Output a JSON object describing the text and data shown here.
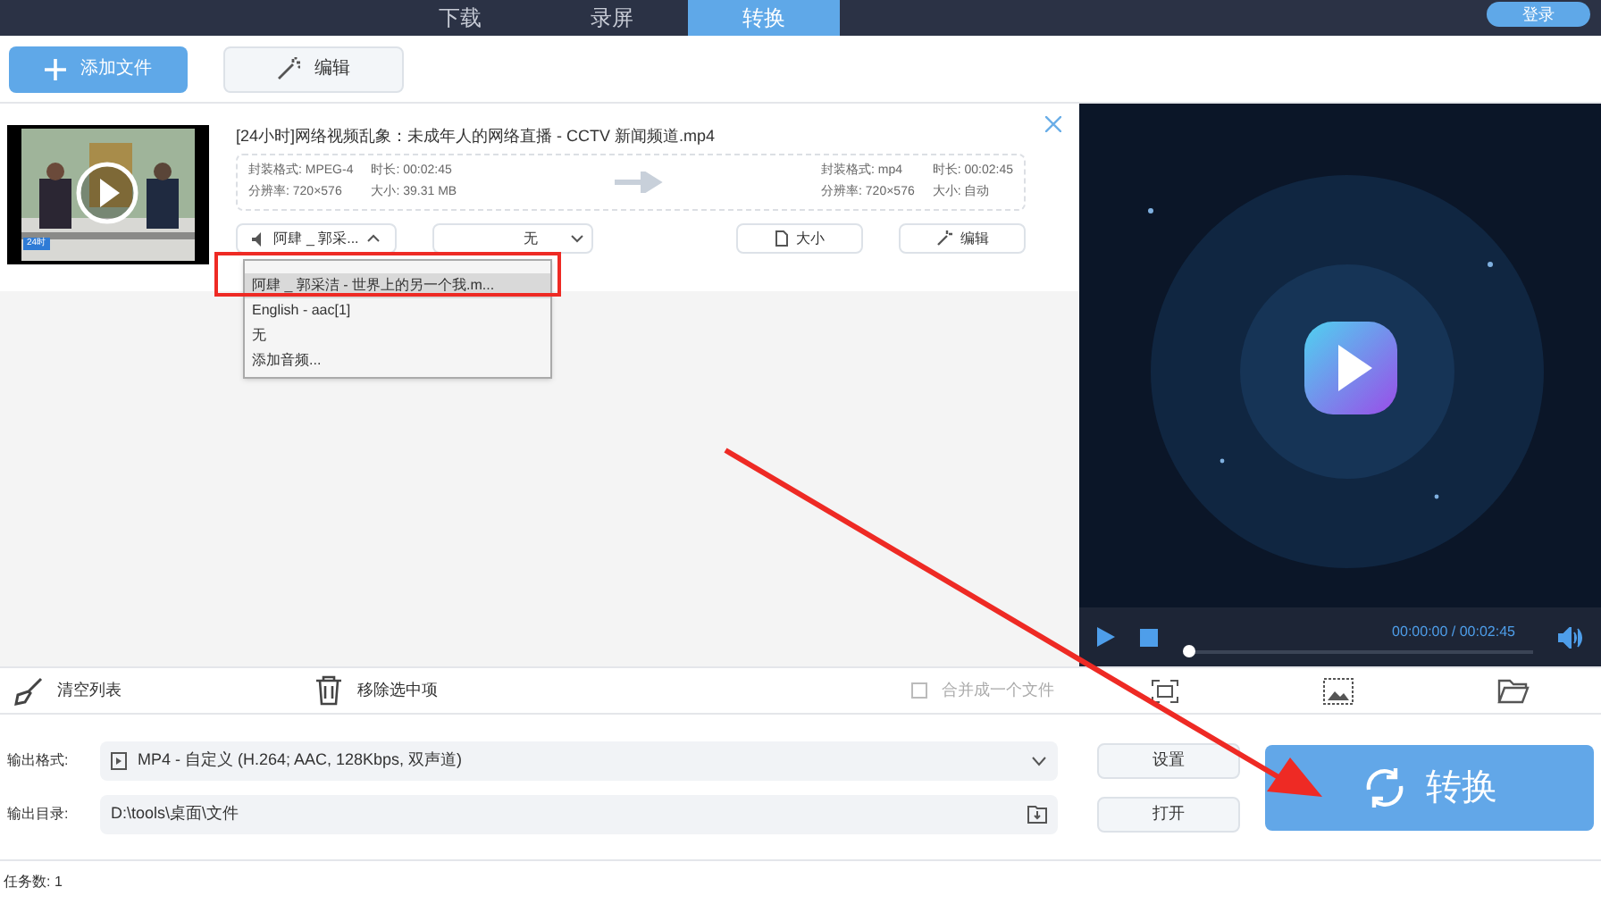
{
  "top_tabs": [
    {
      "label": "下载",
      "selected": false
    },
    {
      "label": "录屏",
      "selected": false
    },
    {
      "label": "转换",
      "selected": true
    }
  ],
  "login_button": "登录",
  "toolbar": {
    "add_file": "添加文件",
    "edit": "编辑"
  },
  "file": {
    "title": "[24小时]网络视频乱象：未成年人的网络直播 - CCTV 新闻频道.mp4",
    "source": [
      {
        "label": "封装格式:",
        "value": "MPEG-4"
      },
      {
        "label": "时长:",
        "value": "00:02:45"
      },
      {
        "label": "分辨率:",
        "value": "720×576"
      },
      {
        "label": "大小:",
        "value": "39.31 MB"
      }
    ],
    "target": [
      {
        "label": "封装格式:",
        "value": "mp4"
      },
      {
        "label": "时长:",
        "value": "00:02:45"
      },
      {
        "label": "分辨率:",
        "value": "720×576"
      },
      {
        "label": "大小:",
        "value": "自动"
      }
    ],
    "audio_track": "阿肆 _ 郭采...",
    "subtitle": "无",
    "size_button": "大小",
    "edit_button": "编辑",
    "thumbnail_badge": "24时"
  },
  "audio_menu": {
    "expanded": true,
    "items": [
      {
        "label": "阿肆 _ 郭采洁 - 世界上的另一个我.m...",
        "selected": true
      },
      {
        "label": "English - aac[1]",
        "selected": false
      },
      {
        "label": "无",
        "selected": false
      },
      {
        "label": "添加音频...",
        "selected": false
      }
    ]
  },
  "player": {
    "time": "00:00:00 / 00:02:45",
    "level": 0.0
  },
  "bottom_toolbar": {
    "clear": "清空列表",
    "remove": "移除选中项",
    "merge": {
      "label": "合并成一个文件",
      "checked": false
    }
  },
  "output": {
    "format_label": "输出格式:",
    "format": "MP4 - 自定义 (H.264; AAC, 128Kbps, 双声道)",
    "settings": "设置",
    "dir_label": "输出目录:",
    "dir": "D:\\tools\\桌面\\文件",
    "open": "打开",
    "convert": "转换"
  },
  "status_bar": "任务数: 1"
}
